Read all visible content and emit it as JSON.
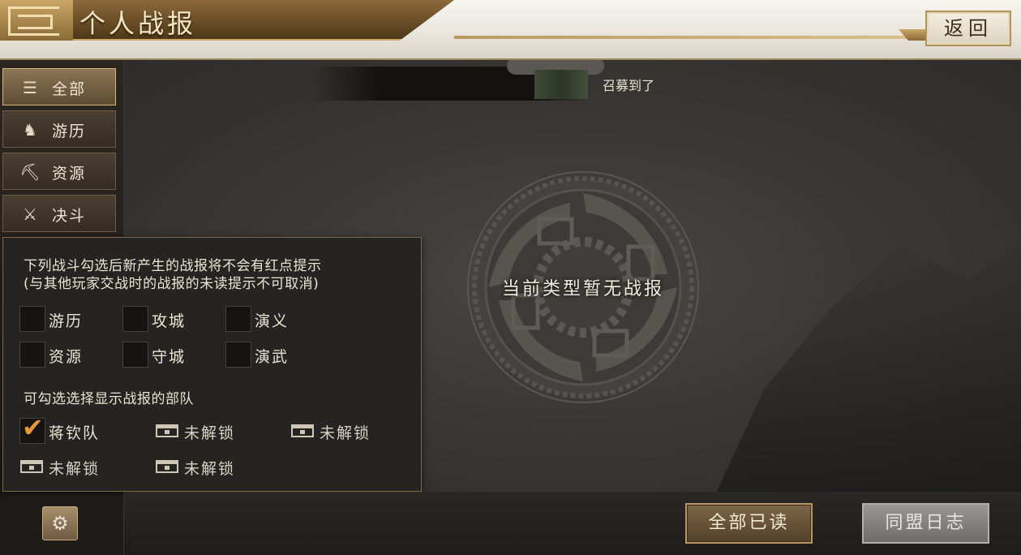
{
  "header": {
    "title": "个人战报",
    "back_label": "返回"
  },
  "notice": {
    "text": "召募到了"
  },
  "main": {
    "empty_message": "当前类型暂无战报"
  },
  "sidebar": {
    "items": [
      {
        "label": "全部",
        "icon": "list-icon",
        "active": true
      },
      {
        "label": "游历",
        "icon": "horse-icon",
        "active": false
      },
      {
        "label": "资源",
        "icon": "pickaxe-icon",
        "active": false
      },
      {
        "label": "决斗",
        "icon": "crossed-swords-icon",
        "active": false
      }
    ],
    "hidden_items": [
      "守城",
      "演义",
      "演武"
    ],
    "settings_icon": "gear-icon"
  },
  "filter_panel": {
    "hint_line1": "下列战斗勾选后新产生的战报将不会有红点提示",
    "hint_line2": "(与其他玩家交战时的战报的未读提示不可取消)",
    "battle_types": [
      {
        "label": "游历",
        "checked": false
      },
      {
        "label": "攻城",
        "checked": false
      },
      {
        "label": "演义",
        "checked": false
      },
      {
        "label": "资源",
        "checked": false
      },
      {
        "label": "守城",
        "checked": false
      },
      {
        "label": "演武",
        "checked": false
      }
    ],
    "troops_hint": "可勾选选择显示战报的部队",
    "troops": [
      {
        "label": "蒋钦队",
        "state": "checked"
      },
      {
        "label": "未解锁",
        "state": "locked"
      },
      {
        "label": "未解锁",
        "state": "locked"
      },
      {
        "label": "未解锁",
        "state": "locked"
      },
      {
        "label": "未解锁",
        "state": "locked"
      }
    ]
  },
  "bottom": {
    "read_all_label": "全部已读",
    "alliance_log_label": "同盟日志"
  },
  "colors": {
    "accent_gold": "#d8b877",
    "checkmark": "#e59a3a",
    "panel_bg": "#262422"
  }
}
